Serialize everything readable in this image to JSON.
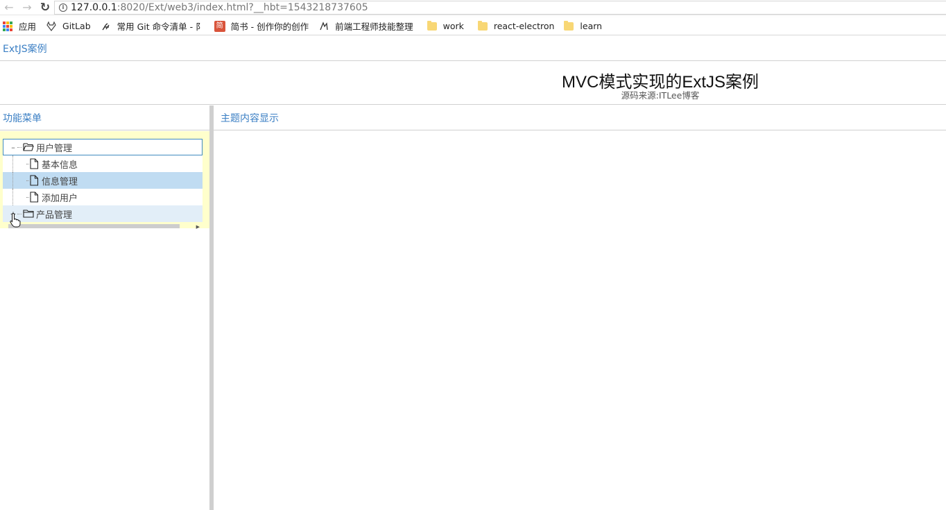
{
  "browser": {
    "url_host": "127.0.0.1",
    "url_rest": ":8020/Ext/web3/index.html?__hbt=1543218737605",
    "bookmarks": [
      {
        "label": "应用",
        "icon": "apps-icon"
      },
      {
        "label": "GitLab",
        "icon": "gitlab-icon"
      },
      {
        "label": "常用 Git 命令清单 - 阝",
        "icon": "git-icon"
      },
      {
        "label": "简书 - 创作你的创作",
        "icon": "jianshu-icon",
        "glyph": "简"
      },
      {
        "label": "前端工程师技能整理",
        "icon": "frontend-icon"
      },
      {
        "label": "work",
        "icon": "folder-icon"
      },
      {
        "label": "react-electron",
        "icon": "folder-icon"
      },
      {
        "label": "learn",
        "icon": "folder-icon"
      }
    ]
  },
  "app": {
    "top_title": "ExtJS案例",
    "banner_title": "MVC模式实现的ExtJS案例",
    "banner_subtitle": "源码来源:ITLee博客",
    "west_title": "功能菜单",
    "center_title": "主题内容显示",
    "tree": {
      "root1": "用户管理",
      "children": [
        "基本信息",
        "信息管理",
        "添加用户"
      ],
      "selected": "信息管理",
      "root2": "产品管理"
    },
    "colors": {
      "accent": "#3b7fc4",
      "selected_row": "#c0dcf2",
      "hover_row": "#e2eef8",
      "tree_bg": "#ffffcc"
    }
  }
}
